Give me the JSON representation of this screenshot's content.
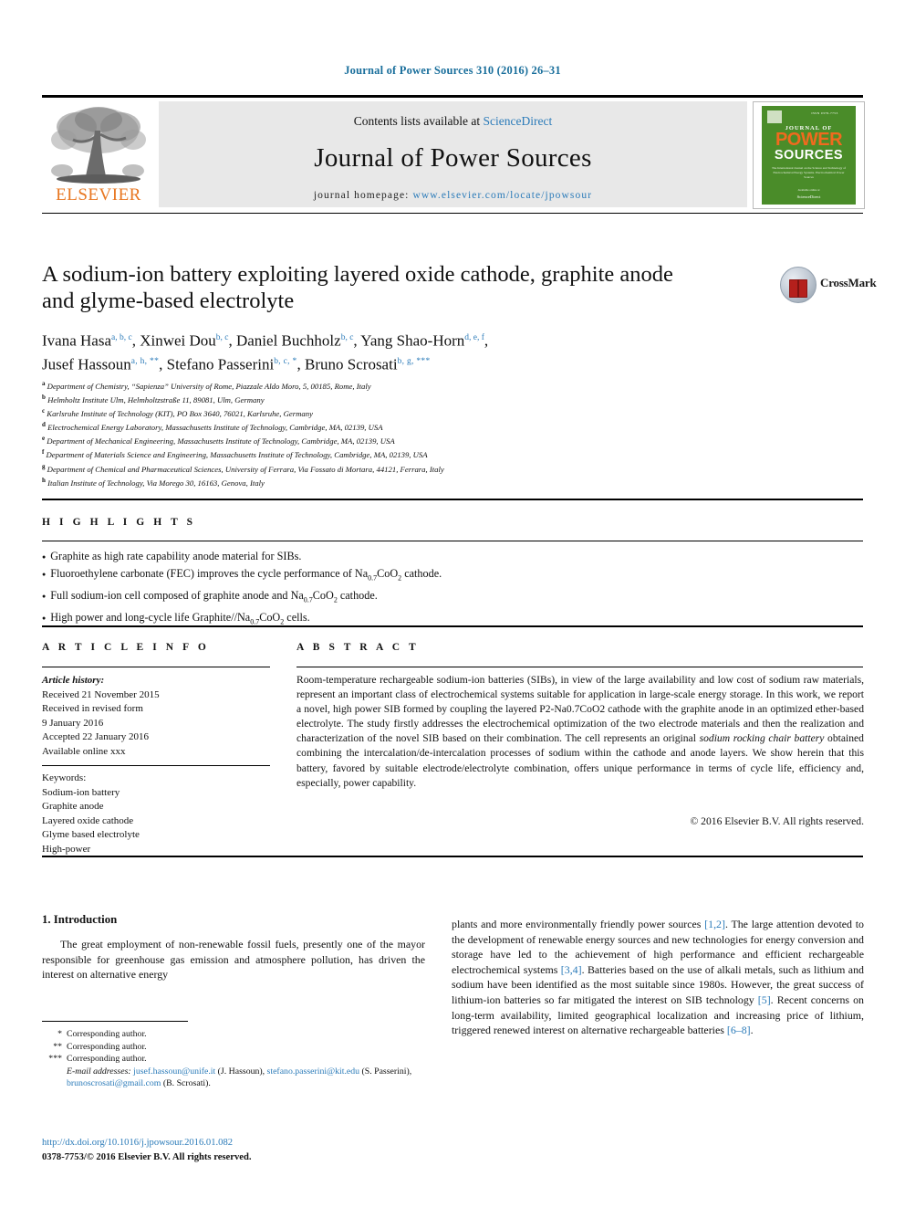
{
  "running_head": "Journal of Power Sources 310 (2016) 26–31",
  "masthead": {
    "publisher_name": "ELSEVIER",
    "contents_prefix": "Contents lists available at ",
    "contents_link": "ScienceDirect",
    "journal_name": "Journal of Power Sources",
    "homepage_prefix": "journal homepage: ",
    "homepage_url": "www.elsevier.com/locate/jpowsour",
    "cover": {
      "top_word": "ISSN 0378-7753",
      "journal_of": "JOURNAL OF",
      "power": "POWER",
      "sources": "SOURCES",
      "blurb": "The International Journal on the Science and Technology of Electrochemical Energy Systems. Electrochemical Power Sources",
      "foot": "Available online at",
      "foot2": "ScienceDirect"
    }
  },
  "article": {
    "title": "A sodium-ion battery exploiting layered oxide cathode, graphite anode and glyme-based electrolyte",
    "crossmark_label": "CrossMark",
    "authors": [
      {
        "name": "Ivana Hasa",
        "marks": "a, b, c",
        "sep": ", "
      },
      {
        "name": "Xinwei Dou",
        "marks": "b, c",
        "sep": ", "
      },
      {
        "name": "Daniel Buchholz",
        "marks": "b, c",
        "sep": ", "
      },
      {
        "name": "Yang Shao-Horn",
        "marks": "d, e, f",
        "sep": ", "
      },
      {
        "name": "Jusef Hassoun",
        "marks": "a, h, **",
        "sep": ", "
      },
      {
        "name": "Stefano Passerini",
        "marks": "b, c, *",
        "sep": ", "
      },
      {
        "name": "Bruno Scrosati",
        "marks": "b, g, ***",
        "sep": ""
      }
    ],
    "affiliations": [
      {
        "mark": "a",
        "text": "Department of Chemistry, “Sapienza” University of Rome, Piazzale Aldo Moro, 5, 00185, Rome, Italy"
      },
      {
        "mark": "b",
        "text": "Helmholtz Institute Ulm, Helmholtzstraße 11, 89081, Ulm, Germany"
      },
      {
        "mark": "c",
        "text": "Karlsruhe Institute of Technology (KIT), PO Box 3640, 76021, Karlsruhe, Germany"
      },
      {
        "mark": "d",
        "text": "Electrochemical Energy Laboratory, Massachusetts Institute of Technology, Cambridge, MA, 02139, USA"
      },
      {
        "mark": "e",
        "text": "Department of Mechanical Engineering, Massachusetts Institute of Technology, Cambridge, MA, 02139, USA"
      },
      {
        "mark": "f",
        "text": "Department of Materials Science and Engineering, Massachusetts Institute of Technology, Cambridge, MA, 02139, USA"
      },
      {
        "mark": "g",
        "text": "Department of Chemical and Pharmaceutical Sciences, University of Ferrara, Via Fossato di Mortara, 44121, Ferrara, Italy"
      },
      {
        "mark": "h",
        "text": "Italian Institute of Technology, Via Morego 30, 16163, Genova, Italy"
      }
    ]
  },
  "highlights": {
    "heading": "H I G H L I G H T S",
    "items": [
      "Graphite as high rate capability anode material for SIBs.",
      "Fluoroethylene carbonate (FEC) improves the cycle performance of Na0.7CoO2 cathode.",
      "Full sodium-ion cell composed of graphite anode and Na0.7CoO2 cathode.",
      "High power and long-cycle life Graphite//Na0.7CoO2 cells."
    ]
  },
  "article_info": {
    "heading": "A R T I C L E   I N F O",
    "history_label": "Article history:",
    "history": [
      "Received 21 November 2015",
      "Received in revised form",
      "9 January 2016",
      "Accepted 22 January 2016",
      "Available online xxx"
    ],
    "keywords_label": "Keywords:",
    "keywords": [
      "Sodium-ion battery",
      "Graphite anode",
      "Layered oxide cathode",
      "Glyme based electrolyte",
      "High-power"
    ]
  },
  "abstract": {
    "heading": "A B S T R A C T",
    "text_part_1": "Room-temperature rechargeable sodium-ion batteries (SIBs), in view of the large availability and low cost of sodium raw materials, represent an important class of electrochemical systems suitable for application in large-scale energy storage. In this work, we report a novel, high power SIB formed by coupling the layered P2-Na0.7CoO2 cathode with the graphite anode in an optimized ether-based electrolyte. The study firstly addresses the electrochemical optimization of the two electrode materials and then the realization and characterization of the novel SIB based on their combination. The cell represents an original ",
    "emphasis": "sodium rocking chair battery",
    "text_part_2": " obtained combining the intercalation/de-intercalation processes of sodium within the cathode and anode layers. We show herein that this battery, favored by suitable electrode/electrolyte combination, offers unique performance in terms of cycle life, efficiency and, especially, power capability.",
    "copyright": "© 2016 Elsevier B.V. All rights reserved."
  },
  "body": {
    "section_heading": "1.  Introduction",
    "left_paragraph_1": "The great employment of non-renewable fossil fuels, presently one of the mayor responsible for greenhouse gas emission and atmosphere pollution, has driven the interest on alternative energy",
    "right_frag_1": "plants and more environmentally friendly power sources ",
    "right_ref_1": "[1,2]",
    "right_frag_2": ". The large attention devoted to the development of renewable energy sources and new technologies for energy conversion and storage have led to the achievement of high performance and efficient rechargeable electrochemical systems ",
    "right_ref_2": "[3,4]",
    "right_frag_3": ". Batteries based on the use of alkali metals, such as lithium and sodium have been identified as the most suitable since 1980s. However, the great success of lithium-ion batteries so far mitigated the interest on SIB technology ",
    "right_ref_3": "[5]",
    "right_frag_4": ". Recent concerns on long-term availability, limited geographical localization and increasing price of lithium, triggered renewed interest on alternative rechargeable batteries ",
    "right_ref_4": "[6–8]",
    "right_frag_5": "."
  },
  "footnotes": {
    "lines": [
      {
        "star": "*",
        "text": "Corresponding author."
      },
      {
        "star": "**",
        "text": "Corresponding author."
      },
      {
        "star": "***",
        "text": "Corresponding author."
      }
    ],
    "email_label": "E-mail addresses:",
    "email_1": "jusef.hassoun@unife.it",
    "email_1_owner": " (J. Hassoun), ",
    "email_2": "stefano.passerini@kit.edu",
    "email_2_owner": " (S. Passerini), ",
    "email_3": "brunoscrosati@gmail.com",
    "email_3_owner": " (B. Scrosati).",
    "doi": "http://dx.doi.org/10.1016/j.jpowsour.2016.01.082",
    "issn": "0378-7753/© 2016 Elsevier B.V. All rights reserved."
  },
  "colors": {
    "link": "#2b7bb9",
    "elsevier_orange": "#e87722",
    "cover_green": "#4a8c29",
    "crossmark_red": "#b5201c"
  }
}
